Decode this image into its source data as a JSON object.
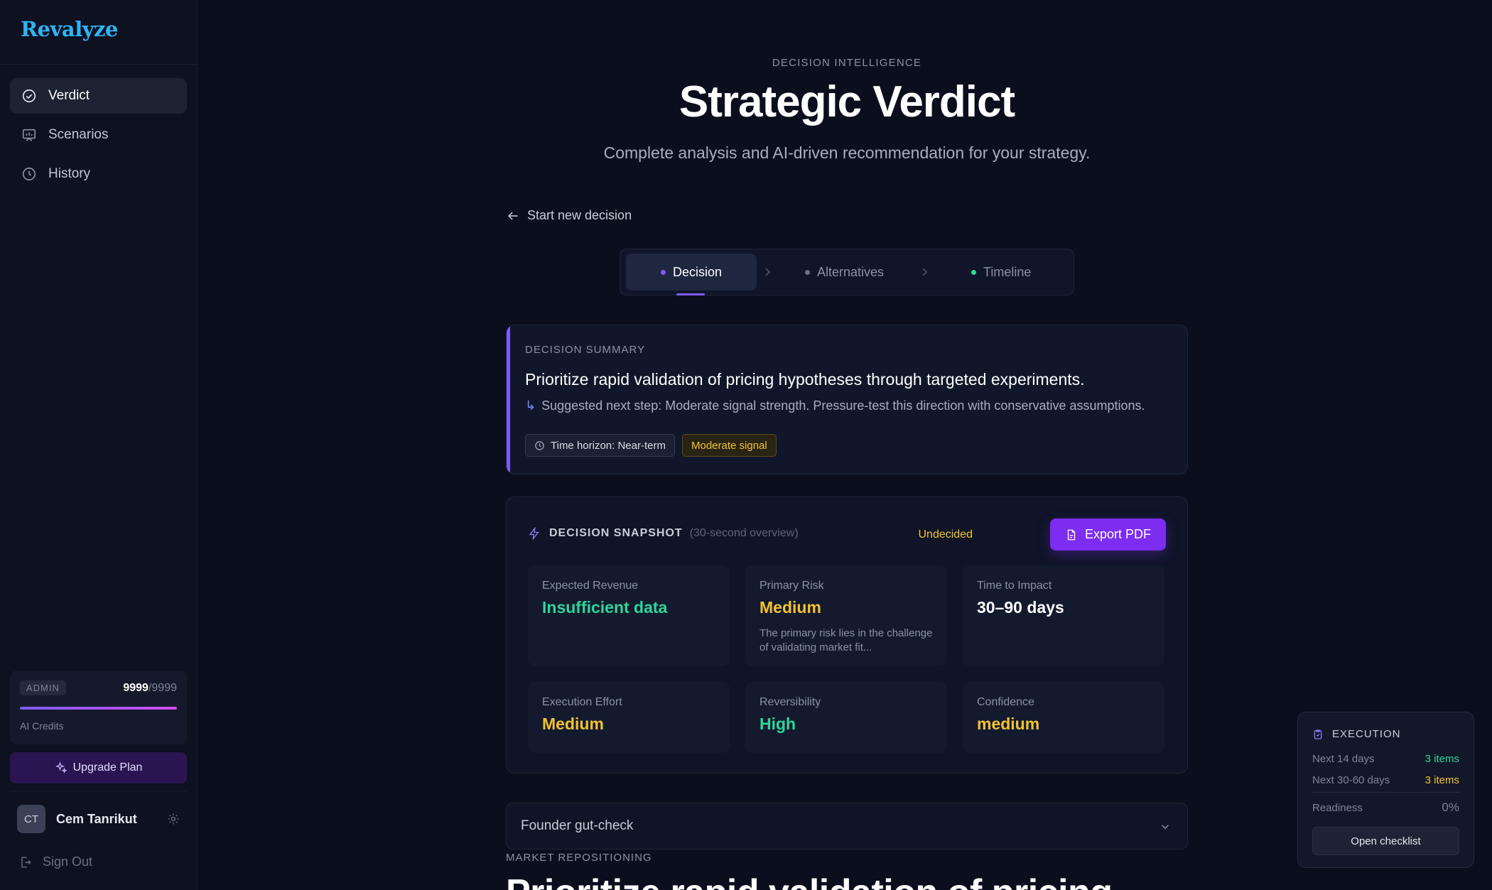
{
  "app": {
    "logo": "Revalyze"
  },
  "sidebar": {
    "items": [
      {
        "label": "Verdict",
        "icon": "check-circle-icon",
        "active": true
      },
      {
        "label": "Scenarios",
        "icon": "chart-board-icon",
        "active": false
      },
      {
        "label": "History",
        "icon": "clock-icon",
        "active": false
      }
    ],
    "credits": {
      "badge": "ADMIN",
      "current": "9999",
      "total": "/9999",
      "label": "AI Credits",
      "fill": 1.0
    },
    "upgrade_label": "Upgrade Plan",
    "user": {
      "initials": "CT",
      "name": "Cem Tanrikut"
    },
    "signout_label": "Sign Out"
  },
  "header": {
    "kicker": "DECISION INTELLIGENCE",
    "title": "Strategic Verdict",
    "subtitle": "Complete analysis and AI-driven recommendation for your strategy."
  },
  "back_label": "Start new decision",
  "steps": [
    {
      "label": "Decision",
      "color": "#7c5cff"
    },
    {
      "label": "Alternatives",
      "color": "#6b7284"
    },
    {
      "label": "Timeline",
      "color": "#2ed69a"
    }
  ],
  "summary": {
    "label": "DECISION SUMMARY",
    "headline": "Prioritize rapid validation of pricing hypotheses through targeted experiments.",
    "next_step": "Suggested next step: Moderate signal strength. Pressure-test this direction with conservative assumptions.",
    "pills": {
      "time_horizon": "Time horizon: Near-term",
      "signal": "Moderate signal"
    }
  },
  "snapshot": {
    "title": "DECISION SNAPSHOT",
    "hint": "(30-second overview)",
    "status": "Undecided",
    "export_label": "Export PDF",
    "metrics": [
      {
        "label": "Expected Revenue",
        "value": "Insufficient data"
      },
      {
        "label": "Primary Risk",
        "value": "Medium",
        "note": "The primary risk lies in the challenge of validating market fit..."
      },
      {
        "label": "Time to Impact",
        "value": "30–90 days"
      },
      {
        "label": "Execution Effort",
        "value": "Medium"
      },
      {
        "label": "Reversibility",
        "value": "High"
      },
      {
        "label": "Confidence",
        "value": "medium"
      }
    ]
  },
  "gutcheck_label": "Founder gut-check",
  "section": {
    "kicker": "MARKET REPOSITIONING",
    "heading": "Prioritize rapid validation of pricing"
  },
  "execution": {
    "title": "EXECUTION",
    "rows": [
      {
        "label": "Next 14 days",
        "value": "3 items"
      },
      {
        "label": "Next 30-60 days",
        "value": "3 items"
      }
    ],
    "readiness_label": "Readiness",
    "readiness_value": "0%",
    "button_label": "Open checklist"
  },
  "colors": {
    "accent": "#7c5cff",
    "export": "#7c2df0",
    "green": "#2ed69a",
    "yellow": "#f2c233",
    "logo": "#2fb4f4"
  }
}
